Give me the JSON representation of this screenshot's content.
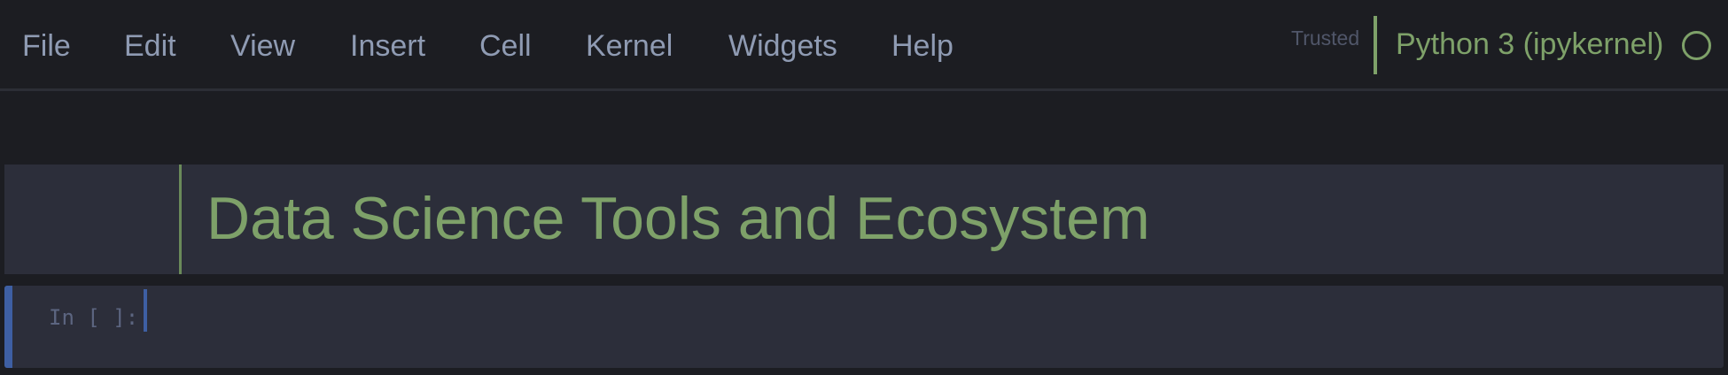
{
  "menubar": {
    "items": [
      {
        "label": "File"
      },
      {
        "label": "Edit"
      },
      {
        "label": "View"
      },
      {
        "label": "Insert"
      },
      {
        "label": "Cell"
      },
      {
        "label": "Kernel"
      },
      {
        "label": "Widgets"
      },
      {
        "label": "Help"
      }
    ],
    "trusted_label": "Trusted",
    "kernel_name": "Python 3 (ipykernel)",
    "kernel_status_icon": "circle-idle-icon"
  },
  "cells": {
    "markdown": {
      "heading": "Data Science Tools and Ecosystem"
    },
    "code": {
      "prompt": "In [ ]:",
      "source": ""
    }
  },
  "colors": {
    "background": "#1c1d22",
    "cell_background": "#2c2e3a",
    "menu_text": "#8f9bb3",
    "accent_green": "#7ea169",
    "selection_blue": "#3e5fa3"
  }
}
